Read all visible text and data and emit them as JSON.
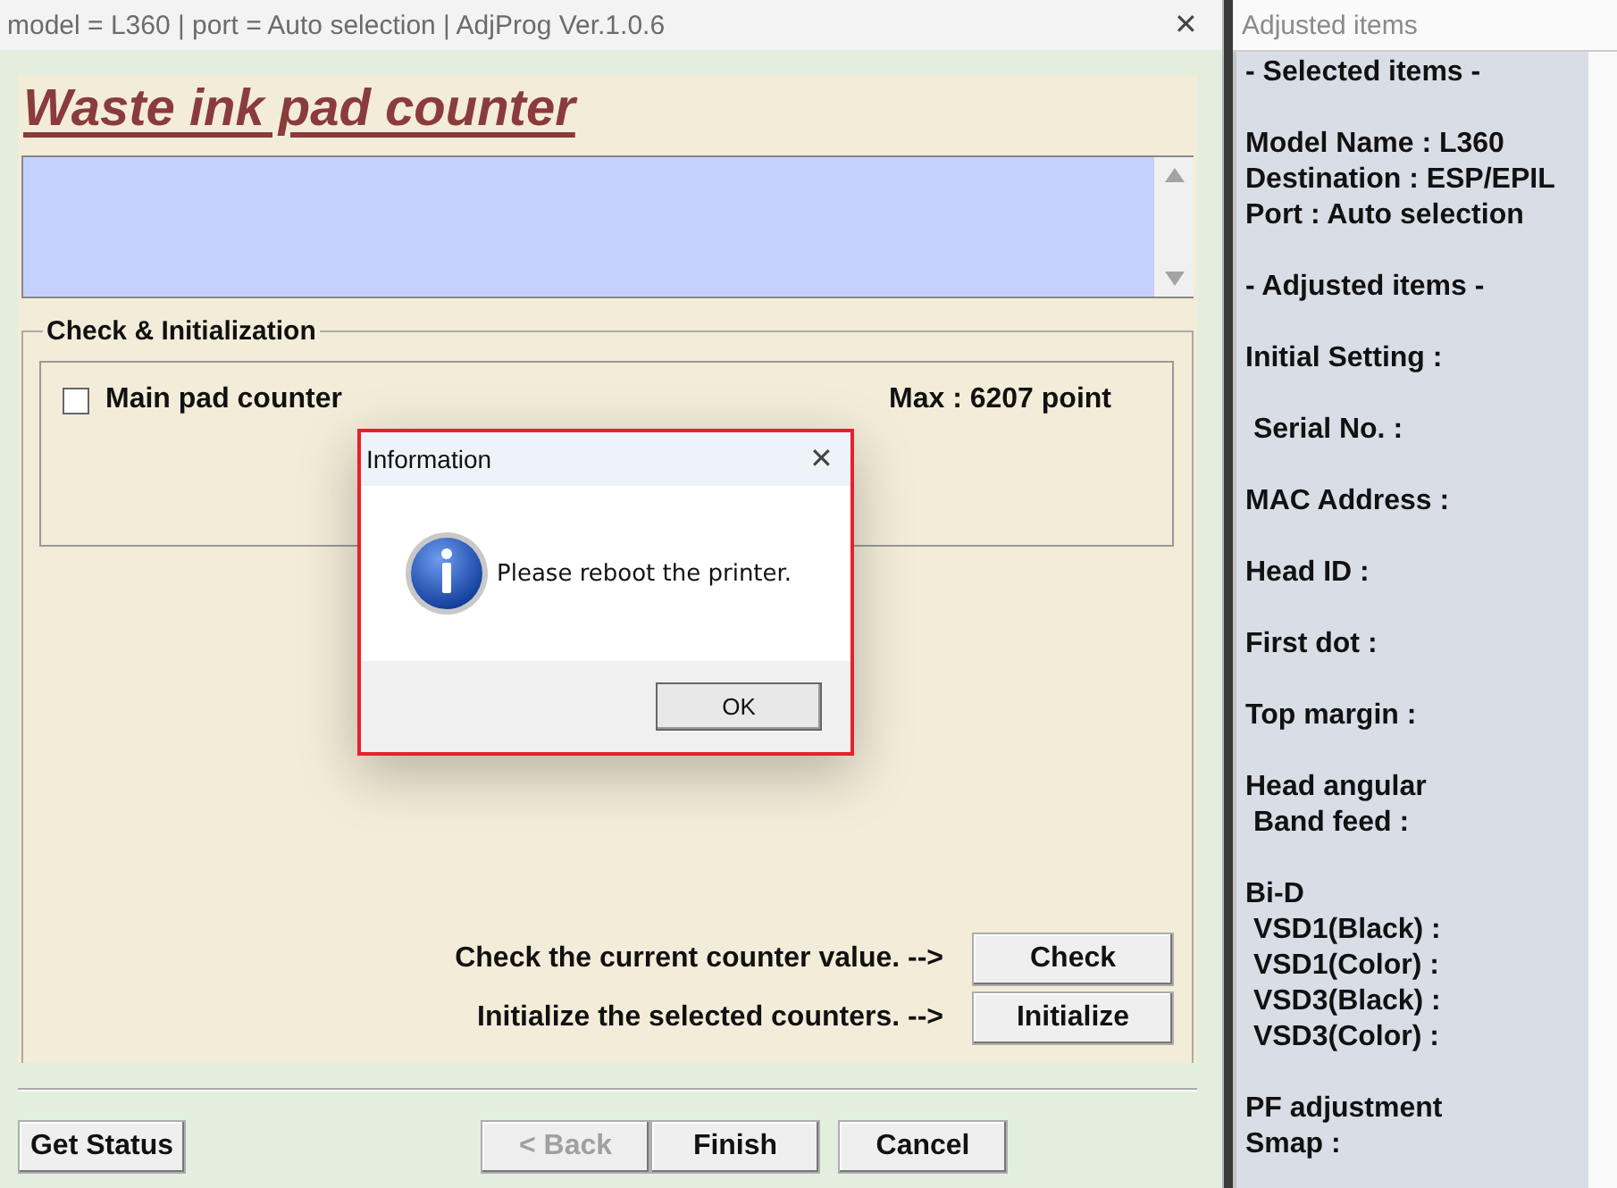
{
  "window": {
    "title": "model = L360 | port = Auto selection | AdjProg Ver.1.0.6",
    "close": "✕"
  },
  "heading": "Waste ink pad counter",
  "group": {
    "title": "Check & Initialization",
    "counters": [
      {
        "label": "Main pad counter",
        "checked": false,
        "max": "Max : 6207 point"
      }
    ],
    "actions": [
      {
        "text": "Check the current counter value. -->",
        "button": "Check"
      },
      {
        "text": "Initialize the selected counters. -->",
        "button": "Initialize"
      }
    ]
  },
  "footer": {
    "buttons": [
      {
        "label": "Get Status",
        "disabled": false
      },
      {
        "label": "< Back",
        "disabled": true
      },
      {
        "label": "Finish",
        "disabled": false
      },
      {
        "label": "Cancel",
        "disabled": false
      }
    ]
  },
  "dialog": {
    "title": "Information",
    "close": "✕",
    "message": "Please reboot the printer.",
    "button": "OK"
  },
  "side_panel": {
    "title": "Adjusted items",
    "groups": [
      [
        "- Selected items -"
      ],
      [
        "Model Name : L360",
        "Destination : ESP/EPIL",
        "Port : Auto selection"
      ],
      [
        "- Adjusted items -"
      ],
      [
        "Initial Setting :"
      ],
      [
        " Serial No. :"
      ],
      [
        "MAC Address :"
      ],
      [
        "Head ID :"
      ],
      [
        "First dot :"
      ],
      [
        "Top margin :"
      ],
      [
        "Head angular",
        " Band feed :"
      ],
      [
        "Bi-D",
        " VSD1(Black) :",
        " VSD1(Color) :",
        " VSD3(Black) :",
        " VSD3(Color) :"
      ],
      [
        "PF adjustment",
        "Smap :"
      ]
    ]
  }
}
